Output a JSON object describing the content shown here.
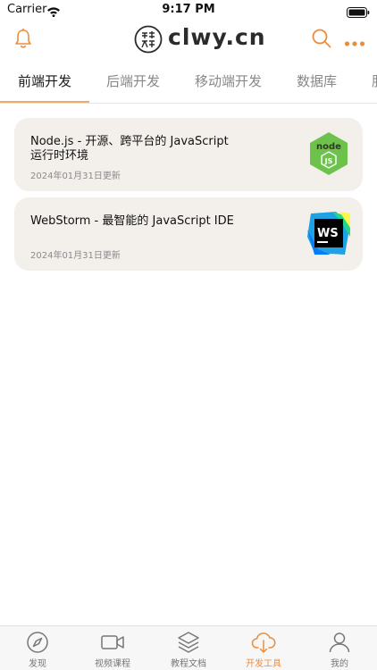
{
  "status": {
    "carrier": "Carrier",
    "time": "9:17 PM"
  },
  "header": {
    "logo_text": "clwy.cn",
    "seal_text": "长乐未央"
  },
  "tabs": [
    {
      "label": "前端开发",
      "active": true
    },
    {
      "label": "后端开发",
      "active": false
    },
    {
      "label": "移动端开发",
      "active": false
    },
    {
      "label": "数据库",
      "active": false
    },
    {
      "label": "服",
      "active": false
    }
  ],
  "tools": [
    {
      "title": "Node.js - 开源、跨平台的 JavaScript 运行时环境",
      "date": "2024年01月31日更新",
      "icon": "nodejs-icon"
    },
    {
      "title": "WebStorm - 最智能的 JavaScript IDE",
      "date": "2024年01月31日更新",
      "icon": "webstorm-icon"
    }
  ],
  "bottom_nav": [
    {
      "label": "发现",
      "icon": "compass-icon",
      "active": false
    },
    {
      "label": "视频课程",
      "icon": "video-icon",
      "active": false
    },
    {
      "label": "教程文档",
      "icon": "layers-icon",
      "active": false
    },
    {
      "label": "开发工具",
      "icon": "cloud-download-icon",
      "active": true
    },
    {
      "label": "我的",
      "icon": "user-icon",
      "active": false
    }
  ],
  "colors": {
    "accent": "#ec8d3e",
    "card_bg": "#f3f0ec",
    "node_green": "#6cc24a",
    "webstorm_blue": "#1ea2e3"
  }
}
